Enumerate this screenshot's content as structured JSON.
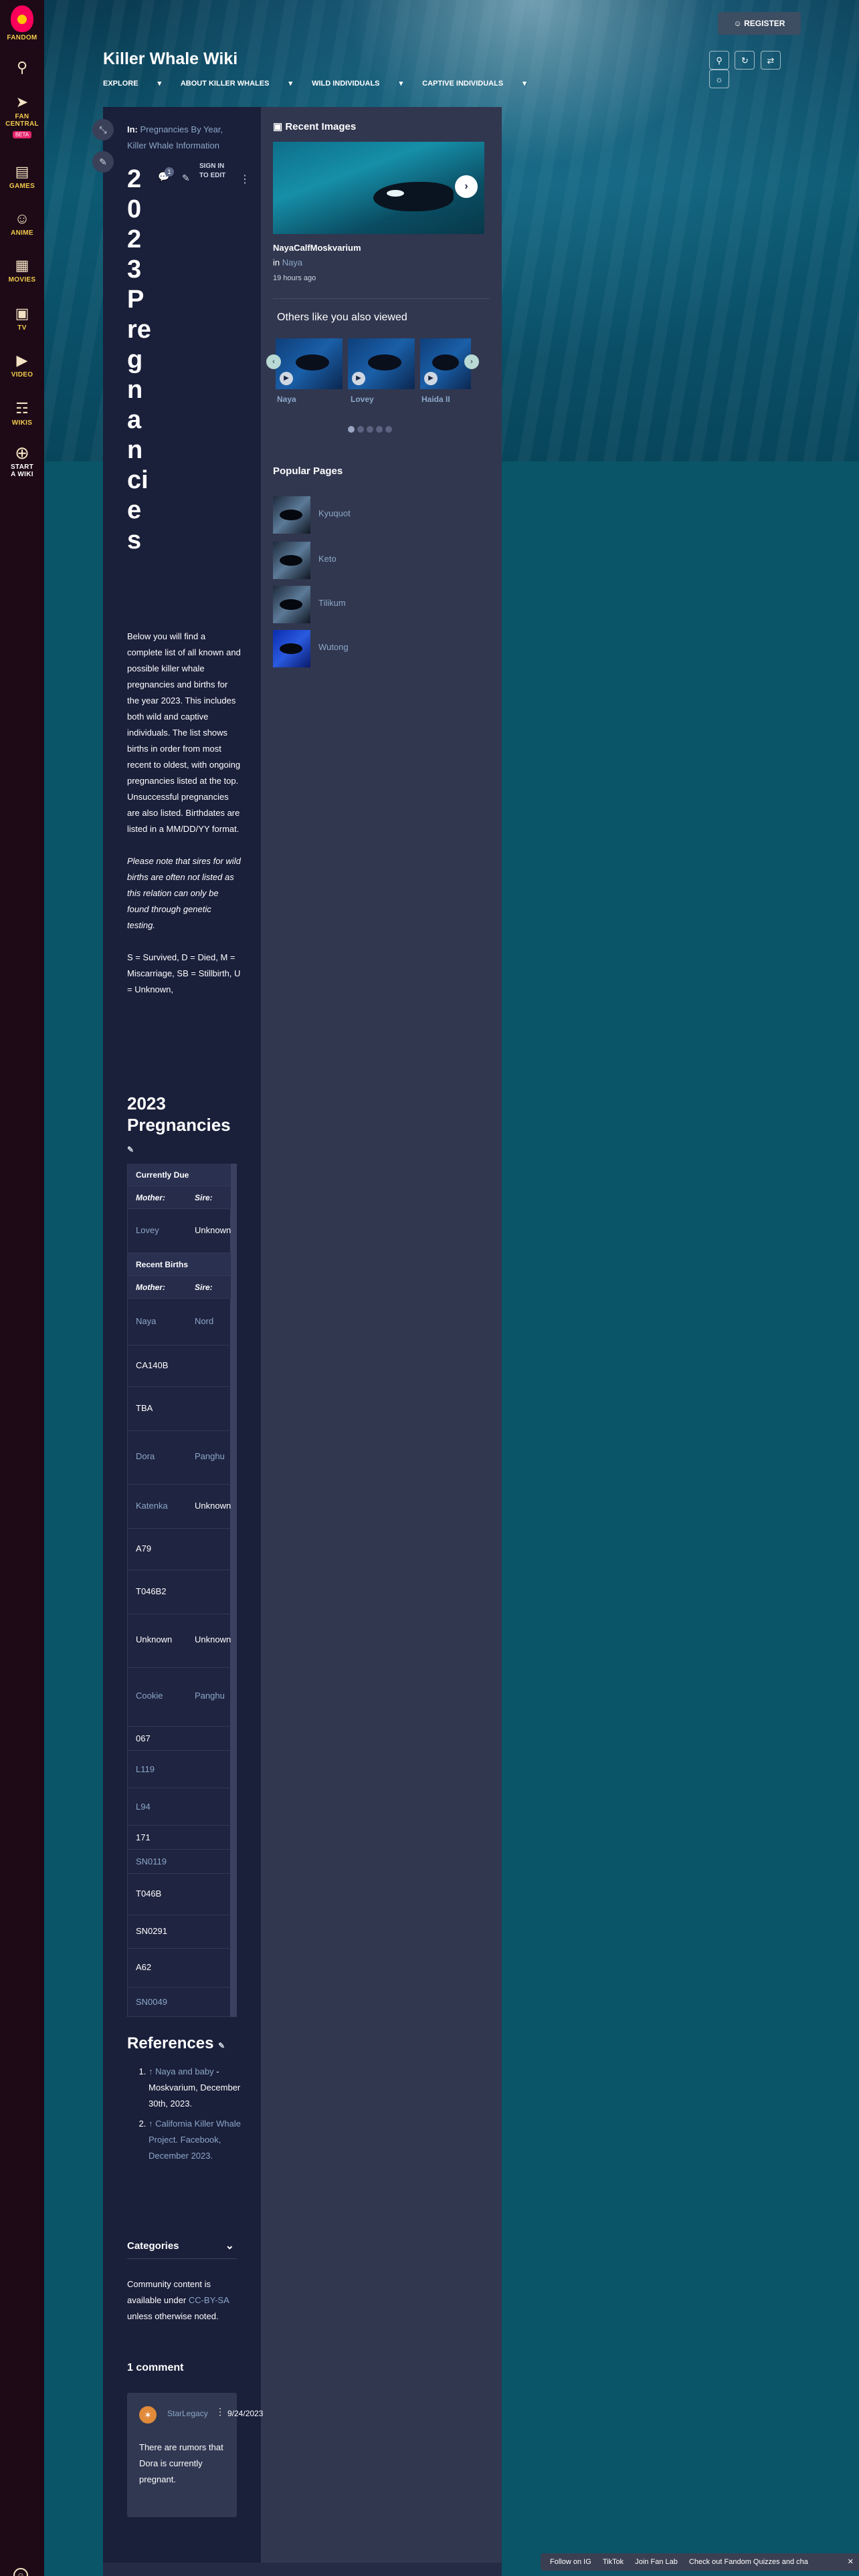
{
  "global_nav": {
    "fandom": "FANDOM",
    "fan_central": "FAN CENTRAL",
    "beta": "BETA",
    "games": "GAMES",
    "anime": "ANIME",
    "movies": "MOVIES",
    "tv": "TV",
    "video": "VIDEO",
    "wikis": "WIKIS",
    "start_a_wiki": "START A WIKI"
  },
  "header": {
    "register": "REGISTER",
    "wiki_title": "Killer Whale Wiki",
    "nav": [
      "EXPLORE",
      "ABOUT KILLER WHALES",
      "CAPTIVE INDIVIDUALS"
    ],
    "nav_wild": "WILD INDIVIDUALS"
  },
  "page": {
    "in_label": "In:",
    "crumb_1": "Pregnancies By Year,",
    "crumb_2": "Killer Whale Information",
    "comment_count": "1",
    "sign_in": "SIGN IN TO EDIT",
    "title": "2023 Pregnancies",
    "intro": "Below you will find a complete list of all known and possible killer whale pregnancies and births for the year 2023. This includes both wild and captive individuals. The list shows births in order from most recent to oldest, with ongoing pregnancies listed at the top. Unsuccessful pregnancies are also listed. Birthdates are listed in a MM/DD/YY format.",
    "note": "Please note that sires for wild births are often not listed as this relation can only be found through genetic testing.",
    "legend": "S = Survived, D = Died, M = Miscarriage, SB = Stillbirth, U = Unknown,",
    "section_heading": "2023 Pregnancies"
  },
  "table": {
    "currently_due": "Currently Due",
    "recent_births": "Recent Births",
    "mother_label": "Mother:",
    "sire_label": "Sire:",
    "due_rows": [
      {
        "mother": "Lovey",
        "sire": "Unknown"
      }
    ],
    "birth_rows": [
      {
        "mother": "Naya",
        "sire": "Nord"
      },
      {
        "mother": "CA140B",
        "sire": ""
      },
      {
        "mother": "TBA",
        "sire": ""
      },
      {
        "mother": "Dora",
        "sire": "Panghu"
      },
      {
        "mother": "Katenka",
        "sire": "Unknown"
      },
      {
        "mother": "A79",
        "sire": ""
      },
      {
        "mother": "T046B2",
        "sire": ""
      },
      {
        "mother": "Unknown",
        "sire": "Unknown"
      },
      {
        "mother": "Cookie",
        "sire": "Panghu"
      },
      {
        "mother": "067",
        "sire": ""
      },
      {
        "mother": "L119",
        "sire": ""
      },
      {
        "mother": "L94",
        "sire": ""
      },
      {
        "mother": "171",
        "sire": ""
      },
      {
        "mother": "SN0119",
        "sire": ""
      },
      {
        "mother": "T046B",
        "sire": ""
      },
      {
        "mother": "SN0291",
        "sire": ""
      },
      {
        "mother": "A62",
        "sire": ""
      },
      {
        "mother": "SN0049",
        "sire": ""
      }
    ]
  },
  "references": {
    "heading": "References",
    "items": [
      {
        "link": "↑ Naya and baby",
        "rest": "- Moskvarium, December 30th, 2023."
      },
      {
        "link": "↑ California Killer Whale Project. Facebook, December 2023.",
        "rest": ""
      }
    ]
  },
  "categories": {
    "label": "Categories"
  },
  "license": {
    "pre": "Community content is available under",
    "link": "CC-BY-SA",
    "post": "unless otherwise noted."
  },
  "comments": {
    "heading": "1 comment",
    "items": [
      {
        "user": "StarLegacy",
        "date": "9/24/2023",
        "text": "There are rumors that Dora is currently pregnant."
      }
    ]
  },
  "right_rail": {
    "recent_images": "Recent Images",
    "image_title": "NayaCalfMoskvarium",
    "image_in": "in",
    "image_page": "Naya",
    "image_time": "19 hours ago",
    "others_heading": "Others like you also viewed",
    "others": [
      "Naya",
      "Lovey",
      "Haida II"
    ],
    "popular_heading": "Popular Pages",
    "popular": [
      "Kyuquot",
      "Keto",
      "Tilikum",
      "Wutong"
    ]
  },
  "footer": {
    "links": [
      "Follow on IG",
      "TikTok",
      "Join Fan Lab",
      "Check out Fandom Quizzes and cha"
    ]
  }
}
